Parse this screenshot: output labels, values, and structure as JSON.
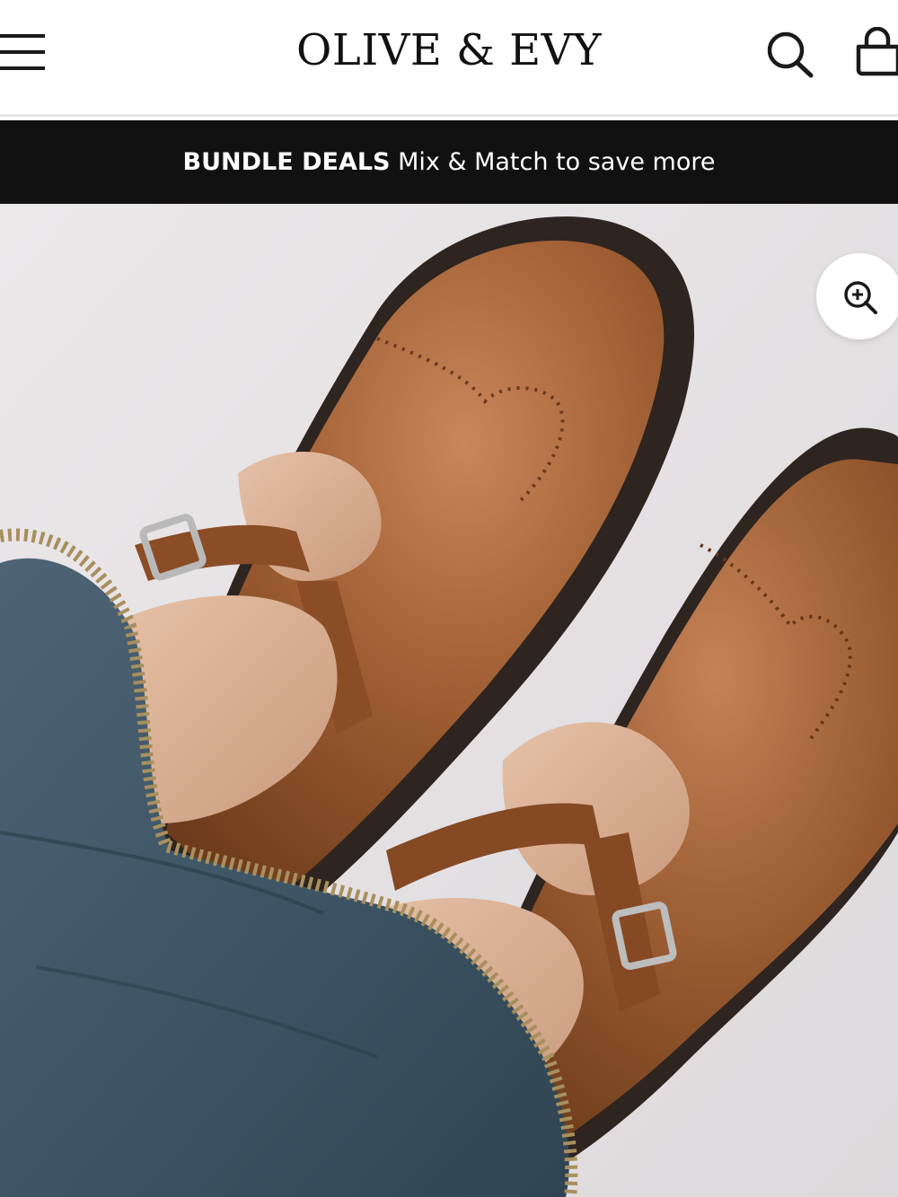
{
  "header": {
    "brand": "OLIVE & EVY",
    "menu_icon": "hamburger-menu-icon",
    "search_icon": "search-icon",
    "cart_icon": "shopping-bag-icon"
  },
  "announcement": {
    "highlight": "BUNDLE DEALS",
    "text": " Mix & Match to save more"
  },
  "product_image": {
    "alt": "Brown leather brogue T-bar shoes",
    "zoom_icon": "zoom-in-icon"
  },
  "colors": {
    "banner_bg": "#111111",
    "leather": "#9a5a2e",
    "sole": "#2e2420",
    "denim": "#3d5566",
    "background": "#e8e4e7"
  }
}
